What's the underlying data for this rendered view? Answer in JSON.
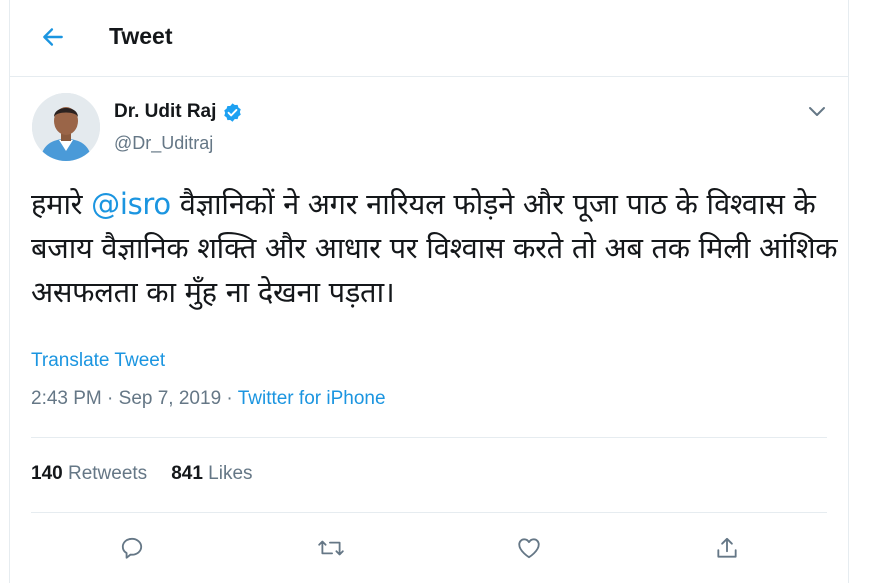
{
  "header": {
    "title": "Tweet"
  },
  "author": {
    "name": "Dr. Udit Raj",
    "handle": "@Dr_Uditraj"
  },
  "tweet": {
    "text_before": "हमारे ",
    "mention": "@isro",
    "text_after": " वैज्ञानिकों ने अगर नारियल फोड़ने और पूजा पाठ के विश्वास के बजाय वैज्ञानिक शक्ति और आधार पर विश्वास करते तो अब तक मिली आंशिक असफलता का मुँह ना देखना पड़ता।"
  },
  "translate_label": "Translate Tweet",
  "meta": {
    "time": "2:43 PM",
    "separator1": " · ",
    "date": "Sep 7, 2019",
    "separator2": " · ",
    "source": "Twitter for iPhone"
  },
  "stats": {
    "retweets_count": "140",
    "retweets_label": " Retweets",
    "likes_count": "841",
    "likes_label": " Likes"
  },
  "colors": {
    "accent": "#1b95e0",
    "muted": "#657786",
    "border": "#e6ecf0",
    "text": "#14171a"
  },
  "icons": [
    "back-arrow-icon",
    "verified-badge-icon",
    "chevron-down-icon",
    "reply-icon",
    "retweet-icon",
    "like-icon",
    "share-icon"
  ]
}
